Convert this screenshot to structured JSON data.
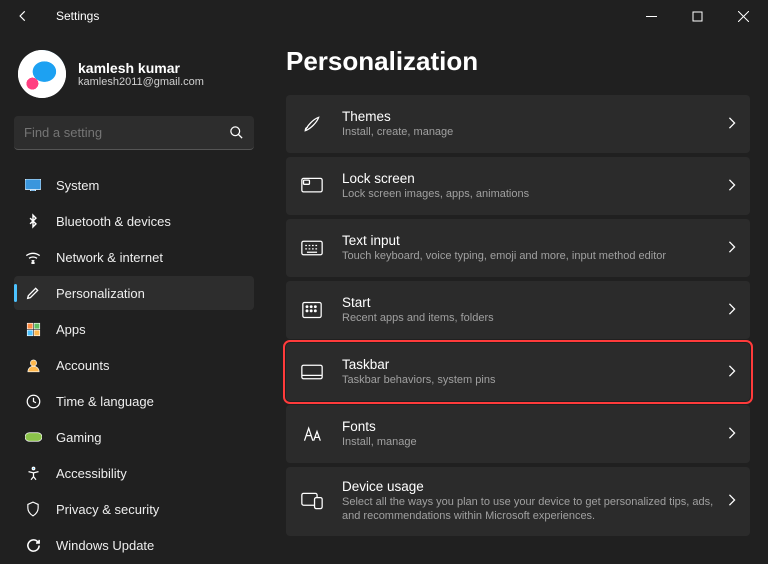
{
  "titlebar": {
    "app_title": "Settings"
  },
  "profile": {
    "name": "kamlesh kumar",
    "email": "kamlesh2011@gmail.com"
  },
  "search": {
    "placeholder": "Find a setting"
  },
  "nav": [
    {
      "label": "System",
      "icon": "system-icon",
      "color": "#3a96dd"
    },
    {
      "label": "Bluetooth & devices",
      "icon": "bluetooth-icon",
      "color": "#3a96dd"
    },
    {
      "label": "Network & internet",
      "icon": "network-icon",
      "color": "#aaaaaa"
    },
    {
      "label": "Personalization",
      "icon": "personalization-icon",
      "color": "#e06c9f",
      "active": true
    },
    {
      "label": "Apps",
      "icon": "apps-icon",
      "color": "#ff8c42"
    },
    {
      "label": "Accounts",
      "icon": "accounts-icon",
      "color": "#ffb84d"
    },
    {
      "label": "Time & language",
      "icon": "time-icon",
      "color": "#cccccc"
    },
    {
      "label": "Gaming",
      "icon": "gaming-icon",
      "color": "#8bc34a"
    },
    {
      "label": "Accessibility",
      "icon": "accessibility-icon",
      "color": "#4cc2ff"
    },
    {
      "label": "Privacy & security",
      "icon": "privacy-icon",
      "color": "#aaaaaa"
    },
    {
      "label": "Windows Update",
      "icon": "update-icon",
      "color": "#4cc2ff"
    }
  ],
  "page": {
    "heading": "Personalization",
    "items": [
      {
        "title": "Themes",
        "desc": "Install, create, manage",
        "icon": "brush-icon"
      },
      {
        "title": "Lock screen",
        "desc": "Lock screen images, apps, animations",
        "icon": "lock-screen-icon"
      },
      {
        "title": "Text input",
        "desc": "Touch keyboard, voice typing, emoji and more, input method editor",
        "icon": "keyboard-icon"
      },
      {
        "title": "Start",
        "desc": "Recent apps and items, folders",
        "icon": "start-icon"
      },
      {
        "title": "Taskbar",
        "desc": "Taskbar behaviors, system pins",
        "icon": "taskbar-icon",
        "highlight": true
      },
      {
        "title": "Fonts",
        "desc": "Install, manage",
        "icon": "fonts-icon"
      },
      {
        "title": "Device usage",
        "desc": "Select all the ways you plan to use your device to get personalized tips, ads, and recommendations within Microsoft experiences.",
        "icon": "device-usage-icon"
      }
    ]
  }
}
